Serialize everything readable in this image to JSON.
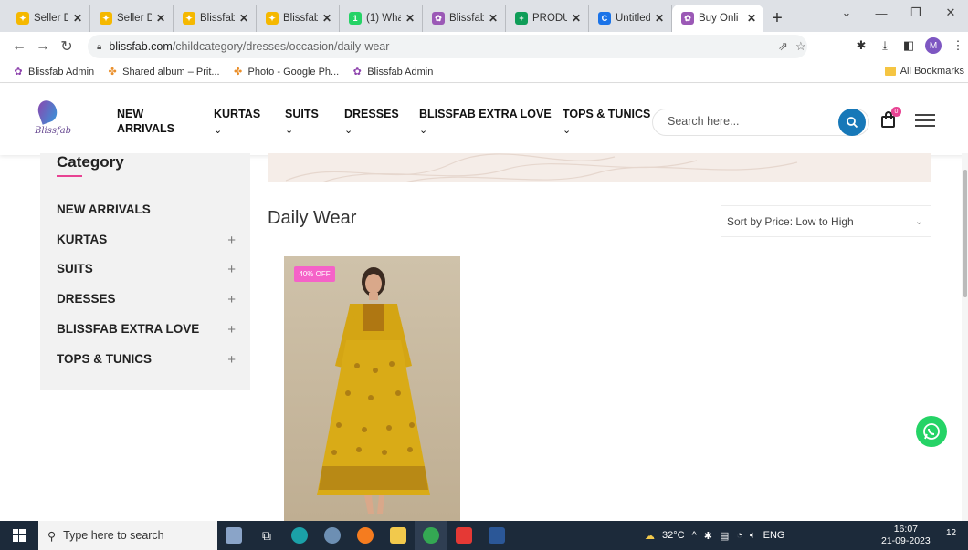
{
  "browser": {
    "tabs": [
      {
        "title": "Seller Da",
        "color": "#f5b800",
        "glyph": "✦"
      },
      {
        "title": "Seller Da",
        "color": "#f5b800",
        "glyph": "✦"
      },
      {
        "title": "Blissfab",
        "color": "#f5b800",
        "glyph": "✦"
      },
      {
        "title": "Blissfab",
        "color": "#f5b800",
        "glyph": "✦"
      },
      {
        "title": "(1) What",
        "color": "#25d366",
        "glyph": "1"
      },
      {
        "title": "Blissfab",
        "color": "#9b59b6",
        "glyph": "✿"
      },
      {
        "title": "PRODUC",
        "color": "#0f9d58",
        "glyph": "+"
      },
      {
        "title": "Untitled",
        "color": "#1a73e8",
        "glyph": "C"
      },
      {
        "title": "Buy Onli",
        "color": "#9b59b6",
        "glyph": "✿"
      }
    ],
    "new_tab": "+",
    "url_host": "blissfab.com",
    "url_path": "/childcategory/dresses/occasion/daily-wear",
    "profile_initial": "M",
    "bookmarks": [
      {
        "label": "Blissfab Admin",
        "icon": "blissfab-icon"
      },
      {
        "label": "Shared album – Prit...",
        "icon": "photos-icon"
      },
      {
        "label": "Photo - Google Ph...",
        "icon": "photos-icon"
      },
      {
        "label": "Blissfab Admin",
        "icon": "blissfab-icon"
      }
    ],
    "all_bookmarks": "All Bookmarks"
  },
  "site": {
    "logo_text": "Blissfab",
    "nav": [
      {
        "label": "NEW\nARRIVALS",
        "line1": "NEW",
        "line2": "ARRIVALS",
        "has_dropdown": false
      },
      {
        "label": "KURTAS",
        "has_dropdown": true
      },
      {
        "label": "SUITS",
        "has_dropdown": true
      },
      {
        "label": "DRESSES",
        "has_dropdown": true
      },
      {
        "label": "BLISSFAB EXTRA LOVE",
        "has_dropdown": true
      },
      {
        "label": "TOPS & TUNICS",
        "has_dropdown": true
      }
    ],
    "search_placeholder": "Search here...",
    "cart_count": "0",
    "accent": "#e84393",
    "search_button_color": "#1778b8"
  },
  "sidebar": {
    "title": "Category",
    "items": [
      {
        "label": "NEW ARRIVALS",
        "expandable": false
      },
      {
        "label": "KURTAS",
        "expandable": true
      },
      {
        "label": "SUITS",
        "expandable": true
      },
      {
        "label": "DRESSES",
        "expandable": true
      },
      {
        "label": "BLISSFAB EXTRA LOVE",
        "expandable": true
      },
      {
        "label": "TOPS & TUNICS",
        "expandable": true
      }
    ],
    "expand_glyph": "+"
  },
  "main": {
    "page_title": "Daily Wear",
    "sort_selected": "Sort by Price: Low to High",
    "products": [
      {
        "discount_badge": "40% OFF",
        "image": "yellow-printed-maxi-dress"
      }
    ]
  },
  "taskbar": {
    "search_placeholder": "Type here to search",
    "weather": "32°C",
    "language": "ENG",
    "time": "16:07",
    "date": "21-09-2023",
    "notifications": "12"
  }
}
